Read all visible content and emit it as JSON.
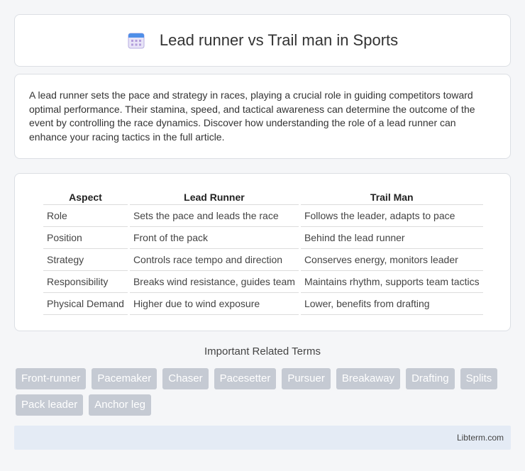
{
  "header": {
    "title": "Lead runner vs Trail man in Sports",
    "icon": "calendar-icon"
  },
  "intro": {
    "text": "A lead runner sets the pace and strategy in races, playing a crucial role in guiding competitors toward optimal performance. Their stamina, speed, and tactical awareness can determine the outcome of the event by controlling the race dynamics. Discover how understanding the role of a lead runner can enhance your racing tactics in the full article."
  },
  "table": {
    "headers": [
      "Aspect",
      "Lead Runner",
      "Trail Man"
    ],
    "rows": [
      [
        "Role",
        "Sets the pace and leads the race",
        "Follows the leader, adapts to pace"
      ],
      [
        "Position",
        "Front of the pack",
        "Behind the lead runner"
      ],
      [
        "Strategy",
        "Controls race tempo and direction",
        "Conserves energy, monitors leader"
      ],
      [
        "Responsibility",
        "Breaks wind resistance, guides team",
        "Maintains rhythm, supports team tactics"
      ],
      [
        "Physical Demand",
        "Higher due to wind exposure",
        "Lower, benefits from drafting"
      ]
    ]
  },
  "terms": {
    "title": "Important Related Terms",
    "items": [
      "Front-runner",
      "Pacemaker",
      "Chaser",
      "Pacesetter",
      "Pursuer",
      "Breakaway",
      "Drafting",
      "Splits",
      "Pack leader",
      "Anchor leg"
    ]
  },
  "footer": {
    "text": "Libterm.com"
  },
  "colors": {
    "tag_bg": "#c5cad3",
    "footer_bg": "#e4ebf5",
    "page_bg": "#f5f6f8"
  }
}
